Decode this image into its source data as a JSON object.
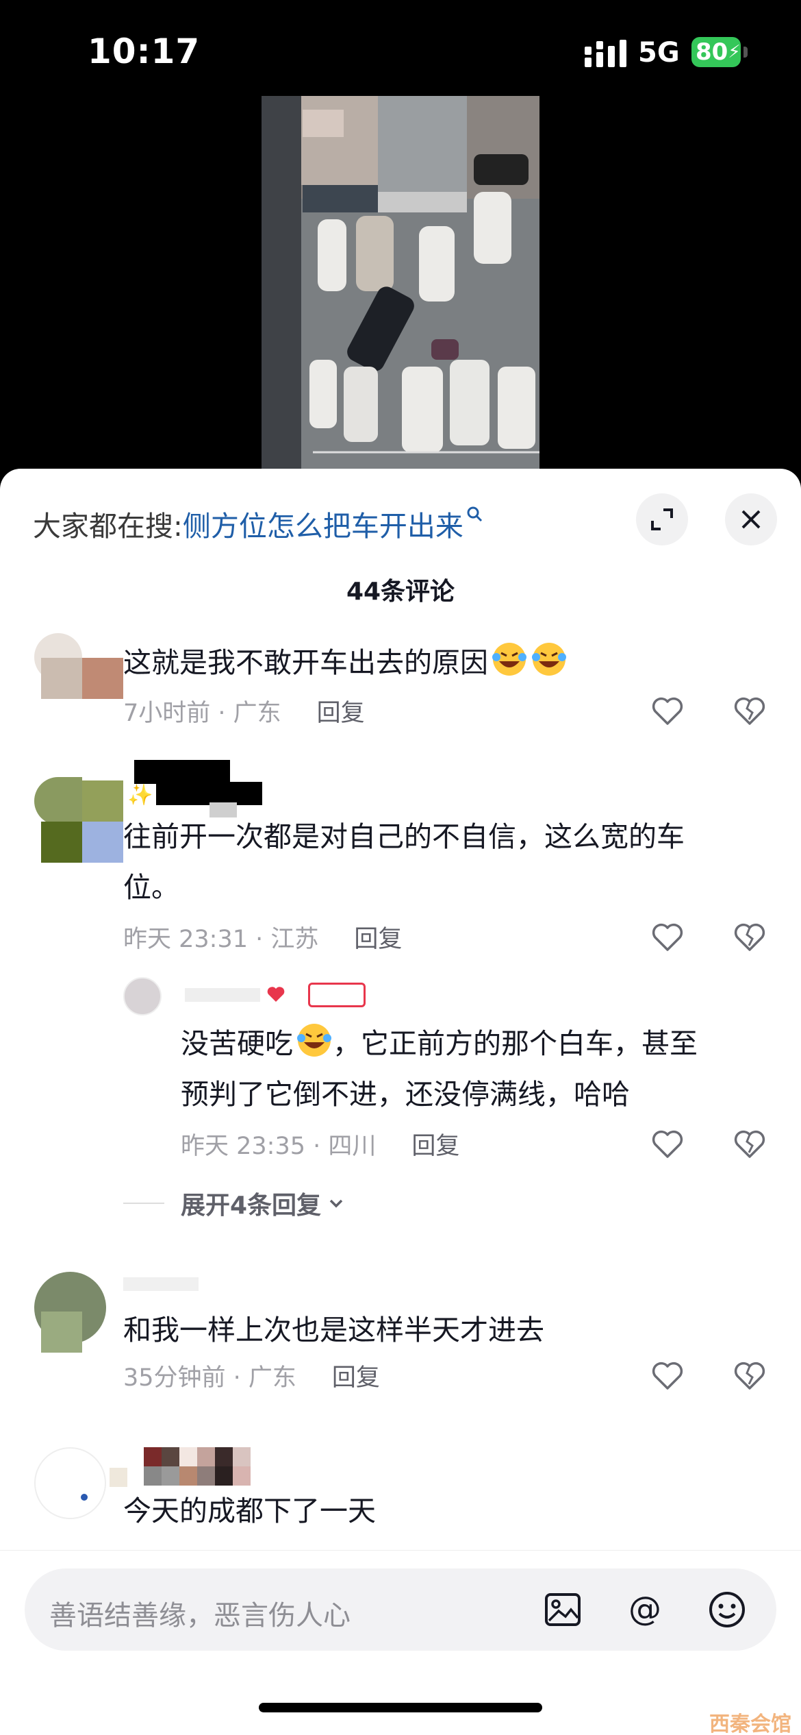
{
  "status_bar": {
    "time": "10:17",
    "network": "5G",
    "battery": "80"
  },
  "sheet": {
    "search_prefix": "大家都在搜:",
    "search_query": "侧方位怎么把车开出来",
    "comment_count": "44条评论"
  },
  "comments": [
    {
      "text": "这就是我不敢开车出去的原因",
      "time_location": "7小时前 · 广东",
      "reply_label": "回复"
    },
    {
      "text_line1": "往前开一次都是对自己的不自信，这么宽的车",
      "text_line2": "位。",
      "time_location": "昨天 23:31 · 江苏",
      "reply_label": "回复"
    },
    {
      "text_line1a": "没苦硬吃",
      "text_line1b": "，它正前方的那个白车，甚至",
      "text_line2": "预判了它倒不进，还没停满线，哈哈",
      "time_location": "昨天 23:35 · 四川",
      "reply_label": "回复"
    },
    {
      "text": "和我一样上次也是这样半天才进去",
      "time_location": "35分钟前 · 广东",
      "reply_label": "回复"
    },
    {
      "text": "今天的成都下了一天"
    }
  ],
  "expand_replies": "展开4条回复",
  "composer": {
    "placeholder": "善语结善缘，恶言伤人心"
  },
  "watermark": "西秦会馆",
  "colors": {
    "link": "#1f5ea8",
    "battery": "#34c759",
    "meta": "#a0a0a6"
  }
}
